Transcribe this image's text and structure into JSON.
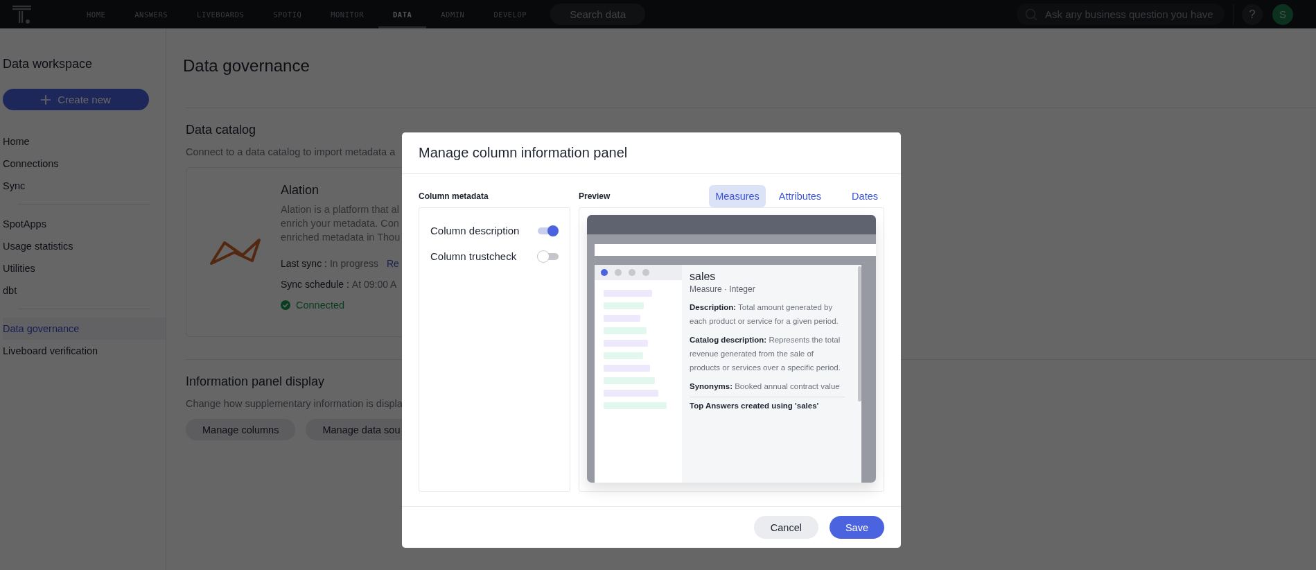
{
  "nav": {
    "items": [
      {
        "label": "HOME",
        "selected": false
      },
      {
        "label": "ANSWERS",
        "selected": false
      },
      {
        "label": "LIVEBOARDS",
        "selected": false
      },
      {
        "label": "SPOTIQ",
        "selected": false
      },
      {
        "label": "MONITOR",
        "selected": false
      },
      {
        "label": "DATA",
        "selected": true
      },
      {
        "label": "ADMIN",
        "selected": false
      },
      {
        "label": "DEVELOP",
        "selected": false
      }
    ],
    "search_button": "Search data",
    "ask_placeholder": "Ask any business question you have",
    "help": "?",
    "avatar": "S"
  },
  "sidebar": {
    "title": "Data workspace",
    "create_button": "Create new",
    "groups": [
      [
        {
          "label": "Home",
          "selected": false
        },
        {
          "label": "Connections",
          "selected": false
        },
        {
          "label": "Sync",
          "selected": false
        }
      ],
      [
        {
          "label": "SpotApps",
          "selected": false
        },
        {
          "label": "Usage statistics",
          "selected": false
        },
        {
          "label": "Utilities",
          "selected": false
        },
        {
          "label": "dbt",
          "selected": false
        }
      ],
      [
        {
          "label": "Data governance",
          "selected": true
        },
        {
          "label": "Liveboard verification",
          "selected": false
        }
      ]
    ]
  },
  "main": {
    "title": "Data governance",
    "data_catalog": {
      "title": "Data catalog",
      "description": "Connect to a data catalog to import metadata a",
      "connector": {
        "name": "Alation",
        "description_lines": [
          "Alation is a platform that al",
          "enrich your metadata. Con",
          "enriched metadata in Thou"
        ],
        "last_sync_label": "Last sync :",
        "last_sync_value": "In progress",
        "last_sync_link": "Re",
        "schedule_label": "Sync schedule :",
        "schedule_value": "At 09:00 A",
        "status": "Connected"
      }
    },
    "info_panel": {
      "title": "Information panel display",
      "description": "Change how supplementary information is displa",
      "buttons": [
        "Manage columns",
        "Manage data sou"
      ]
    }
  },
  "modal": {
    "title": "Manage column information panel",
    "metadata_label": "Column metadata",
    "toggles": [
      {
        "label": "Column description",
        "on": true
      },
      {
        "label": "Column trustcheck",
        "on": false
      }
    ],
    "preview_label": "Preview",
    "tabs": [
      {
        "label": "Measures",
        "selected": true
      },
      {
        "label": "Attributes",
        "selected": false
      },
      {
        "label": "Dates",
        "selected": false
      }
    ],
    "preview": {
      "column_name": "sales",
      "subtitle": "Measure · Integer",
      "fields": [
        "**Description:** Total amount generated by each product or service for a given period.",
        "**Catalog description:** Represents the total revenue generated from the sale of products or services over a specific period.",
        "**Synonyms:** Booked annual contract value"
      ],
      "top_answers": "Top Answers created using 'sales'"
    },
    "buttons": [
      {
        "label": "Cancel",
        "kind": "secondary"
      },
      {
        "label": "Save",
        "kind": "primary"
      }
    ]
  }
}
